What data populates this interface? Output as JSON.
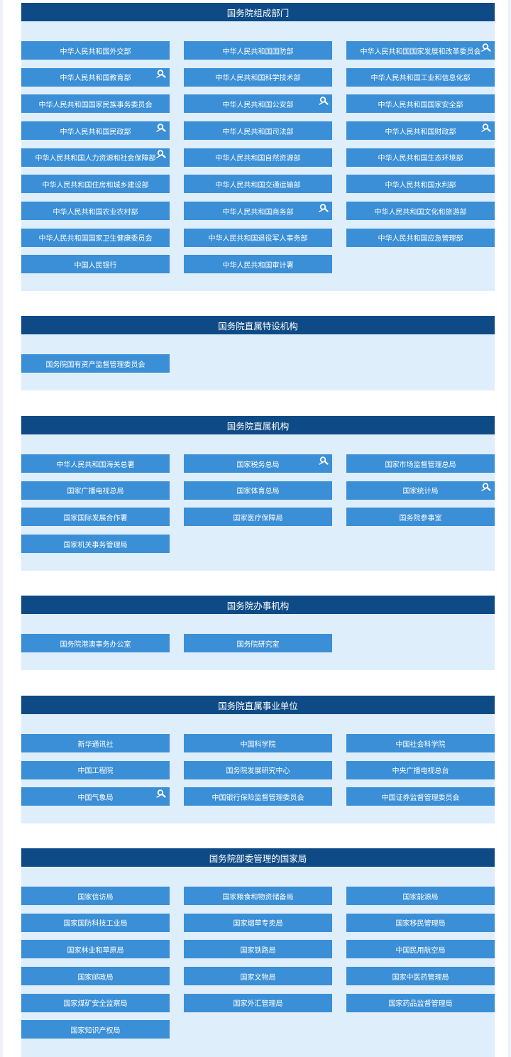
{
  "badge_icon": "magnifier-person-icon",
  "sections": [
    {
      "title": "国务院组成部门",
      "items": [
        {
          "label": "中华人民共和国外交部",
          "badge": false
        },
        {
          "label": "中华人民共和国国防部",
          "badge": false
        },
        {
          "label": "中华人民共和国国家发展和改革委员会",
          "badge": true
        },
        {
          "label": "中华人民共和国教育部",
          "badge": true
        },
        {
          "label": "中华人民共和国科学技术部",
          "badge": false
        },
        {
          "label": "中华人民共和国工业和信息化部",
          "badge": false
        },
        {
          "label": "中华人民共和国国家民族事务委员会",
          "badge": false
        },
        {
          "label": "中华人民共和国公安部",
          "badge": true
        },
        {
          "label": "中华人民共和国国家安全部",
          "badge": false
        },
        {
          "label": "中华人民共和国民政部",
          "badge": true
        },
        {
          "label": "中华人民共和国司法部",
          "badge": false
        },
        {
          "label": "中华人民共和国财政部",
          "badge": true
        },
        {
          "label": "中华人民共和国人力资源和社会保障部",
          "badge": true
        },
        {
          "label": "中华人民共和国自然资源部",
          "badge": false
        },
        {
          "label": "中华人民共和国生态环境部",
          "badge": false
        },
        {
          "label": "中华人民共和国住房和城乡建设部",
          "badge": false
        },
        {
          "label": "中华人民共和国交通运输部",
          "badge": false
        },
        {
          "label": "中华人民共和国水利部",
          "badge": false
        },
        {
          "label": "中华人民共和国农业农村部",
          "badge": false
        },
        {
          "label": "中华人民共和国商务部",
          "badge": true
        },
        {
          "label": "中华人民共和国文化和旅游部",
          "badge": false
        },
        {
          "label": "中华人民共和国国家卫生健康委员会",
          "badge": false
        },
        {
          "label": "中华人民共和国退役军人事务部",
          "badge": false
        },
        {
          "label": "中华人民共和国应急管理部",
          "badge": false
        },
        {
          "label": "中国人民银行",
          "badge": false
        },
        {
          "label": "中华人民共和国审计署",
          "badge": false
        }
      ]
    },
    {
      "title": "国务院直属特设机构",
      "items": [
        {
          "label": "国务院国有资产监督管理委员会",
          "badge": false
        }
      ]
    },
    {
      "title": "国务院直属机构",
      "items": [
        {
          "label": "中华人民共和国海关总署",
          "badge": false
        },
        {
          "label": "国家税务总局",
          "badge": true
        },
        {
          "label": "国家市场监督管理总局",
          "badge": false
        },
        {
          "label": "国家广播电视总局",
          "badge": false
        },
        {
          "label": "国家体育总局",
          "badge": false
        },
        {
          "label": "国家统计局",
          "badge": true
        },
        {
          "label": "国家国际发展合作署",
          "badge": false
        },
        {
          "label": "国家医疗保障局",
          "badge": false
        },
        {
          "label": "国务院参事室",
          "badge": false
        },
        {
          "label": "国家机关事务管理局",
          "badge": false
        }
      ]
    },
    {
      "title": "国务院办事机构",
      "items": [
        {
          "label": "国务院港澳事务办公室",
          "badge": false
        },
        {
          "label": "国务院研究室",
          "badge": false
        }
      ]
    },
    {
      "title": "国务院直属事业单位",
      "items": [
        {
          "label": "新华通讯社",
          "badge": false
        },
        {
          "label": "中国科学院",
          "badge": false
        },
        {
          "label": "中国社会科学院",
          "badge": false
        },
        {
          "label": "中国工程院",
          "badge": false
        },
        {
          "label": "国务院发展研究中心",
          "badge": false
        },
        {
          "label": "中央广播电视总台",
          "badge": false
        },
        {
          "label": "中国气象局",
          "badge": true
        },
        {
          "label": "中国银行保险监督管理委员会",
          "badge": false
        },
        {
          "label": "中国证券监督管理委员会",
          "badge": false
        }
      ]
    },
    {
      "title": "国务院部委管理的国家局",
      "items": [
        {
          "label": "国家信访局",
          "badge": false
        },
        {
          "label": "国家粮食和物资储备局",
          "badge": false
        },
        {
          "label": "国家能源局",
          "badge": false
        },
        {
          "label": "国家国防科技工业局",
          "badge": false
        },
        {
          "label": "国家烟草专卖局",
          "badge": false
        },
        {
          "label": "国家移民管理局",
          "badge": false
        },
        {
          "label": "国家林业和草原局",
          "badge": false
        },
        {
          "label": "国家铁路局",
          "badge": false
        },
        {
          "label": "中国民用航空局",
          "badge": false
        },
        {
          "label": "国家邮政局",
          "badge": false
        },
        {
          "label": "国家文物局",
          "badge": false
        },
        {
          "label": "国家中医药管理局",
          "badge": false
        },
        {
          "label": "国家煤矿安全监察局",
          "badge": false
        },
        {
          "label": "国家外汇管理局",
          "badge": false
        },
        {
          "label": "国家药品监督管理局",
          "badge": false
        },
        {
          "label": "国家知识产权局",
          "badge": false
        }
      ]
    }
  ]
}
